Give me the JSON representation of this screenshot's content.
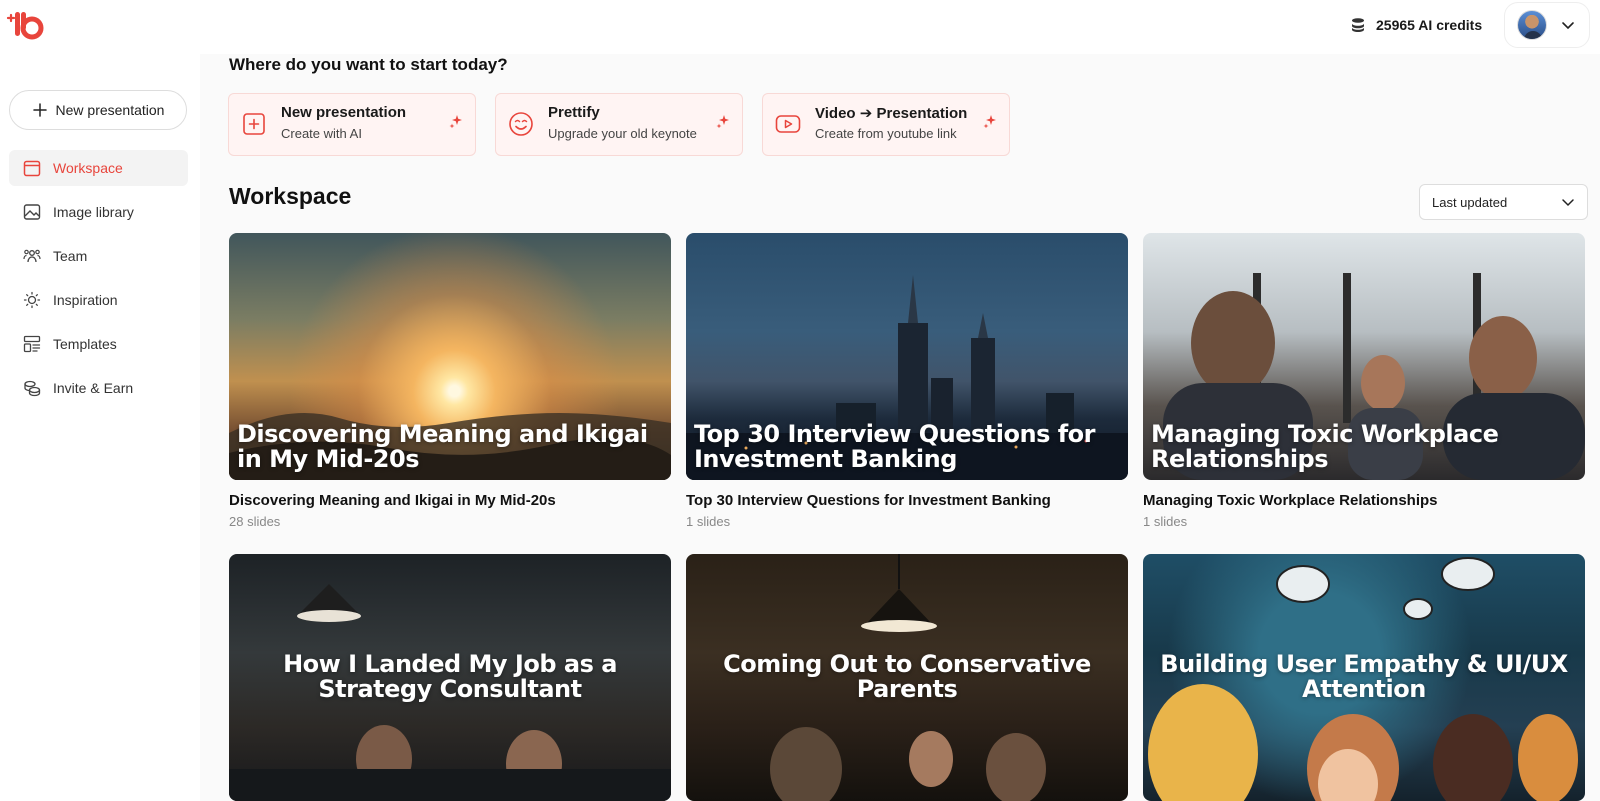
{
  "app": {
    "logo_alt": "ib",
    "credits": "25965 AI credits"
  },
  "sidebar": {
    "new_button": "New presentation",
    "items": [
      {
        "label": "Workspace",
        "icon": "calendar-icon",
        "active": true
      },
      {
        "label": "Image library",
        "icon": "image-icon",
        "active": false
      },
      {
        "label": "Team",
        "icon": "team-icon",
        "active": false
      },
      {
        "label": "Inspiration",
        "icon": "sun-icon",
        "active": false
      },
      {
        "label": "Templates",
        "icon": "templates-icon",
        "active": false
      },
      {
        "label": "Invite & Earn",
        "icon": "coins-icon",
        "active": false
      }
    ]
  },
  "main": {
    "greeting": "Where do you want to start today?",
    "quick_actions": [
      {
        "title": "New presentation",
        "subtitle": "Create with AI",
        "icon": "plus-square-icon"
      },
      {
        "title": "Prettify",
        "subtitle": "Upgrade your old keynote",
        "icon": "smile-icon"
      },
      {
        "title": "Video ➔ Presentation",
        "subtitle": "Create from youtube link",
        "icon": "youtube-icon"
      }
    ],
    "section_title": "Workspace",
    "sort": {
      "selected": "Last updated"
    },
    "cards": [
      {
        "thumb_title": "Discovering Meaning and Ikigai in My Mid-20s",
        "title": "Discovering Meaning and Ikigai in My Mid-20s",
        "slides": "28 slides"
      },
      {
        "thumb_title": "Top 30 Interview Questions for Investment Banking",
        "title": "Top 30 Interview Questions for Investment Banking",
        "slides": "1 slides"
      },
      {
        "thumb_title": "Managing Toxic Workplace Relationships",
        "title": "Managing Toxic Workplace Relationships",
        "slides": "1 slides"
      },
      {
        "thumb_title": "How I Landed My Job as a Strategy Consultant"
      },
      {
        "thumb_title": "Coming Out to Conservative Parents"
      },
      {
        "thumb_title": "Building User Empathy & UI/UX Attention"
      }
    ]
  },
  "colors": {
    "accent": "#e8453c",
    "quick_bg": "#fff4f3"
  }
}
